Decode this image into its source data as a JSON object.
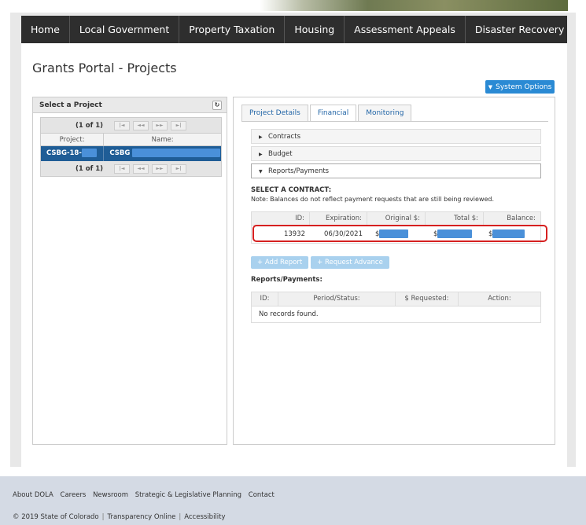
{
  "nav": {
    "items": [
      "Home",
      "Local Government",
      "Property Taxation",
      "Housing",
      "Assessment Appeals",
      "Disaster Recovery"
    ]
  },
  "page": {
    "title": "Grants Portal - Projects"
  },
  "system_options": {
    "label": "System Options"
  },
  "left_panel": {
    "header": "Select a Project",
    "pager_text": "(1 of 1)",
    "columns": [
      "Project:",
      "Name:"
    ],
    "row": {
      "project": "CSBG-18-",
      "name": "CSBG"
    }
  },
  "tabs": [
    "Project Details",
    "Financial",
    "Monitoring"
  ],
  "accordion": [
    "Contracts",
    "Budget",
    "Reports/Payments"
  ],
  "contract": {
    "title": "SELECT A CONTRACT:",
    "note": "Note: Balances do not reflect payment requests that are still being reviewed.",
    "columns": [
      "ID:",
      "Expiration:",
      "Original $:",
      "Total $:",
      "Balance:"
    ],
    "row": {
      "id": "13932",
      "expiration": "06/30/2021",
      "original": "$",
      "total": "$",
      "balance": "$"
    }
  },
  "actions": {
    "add_report": "+ Add Report",
    "request_advance": "+ Request Advance"
  },
  "reports": {
    "title": "Reports/Payments:",
    "columns": [
      "ID:",
      "Period/Status:",
      "$ Requested:",
      "Action:"
    ],
    "empty": "No records found."
  },
  "footer": {
    "links": [
      "About DOLA",
      "Careers",
      "Newsroom",
      "Strategic & Legislative Planning",
      "Contact"
    ],
    "copyright": "© 2019 State of Colorado",
    "transparency": "Transparency Online",
    "accessibility": "Accessibility"
  }
}
